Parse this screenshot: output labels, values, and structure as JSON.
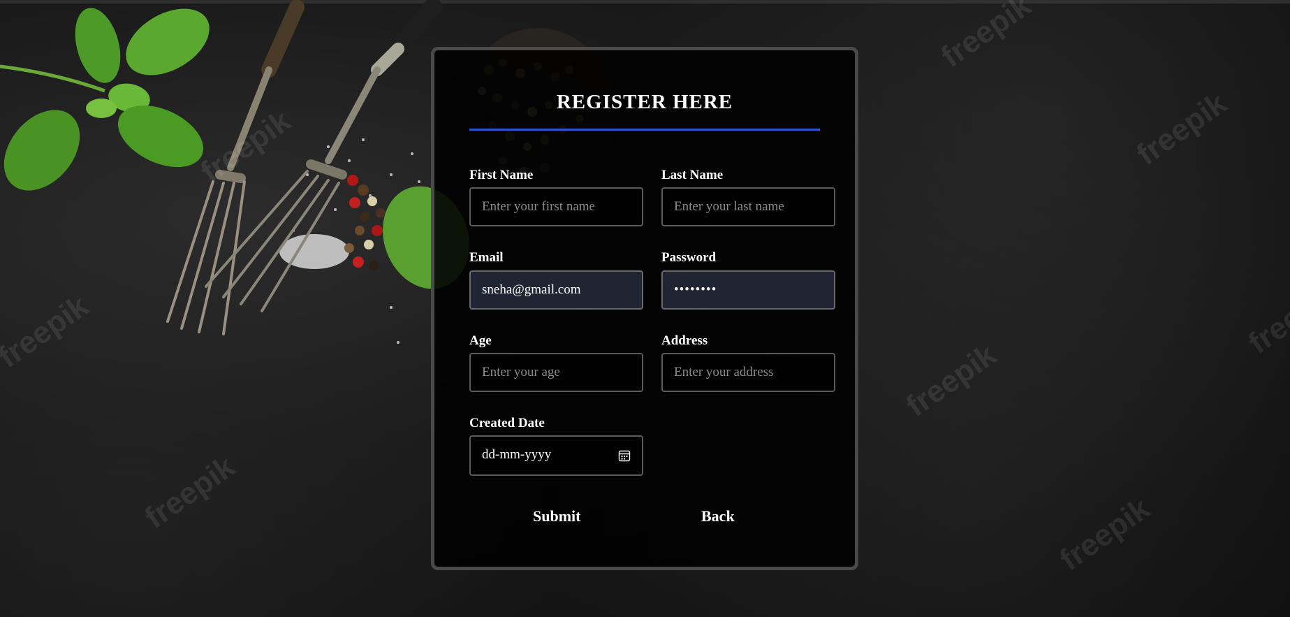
{
  "form": {
    "title": "REGISTER HERE",
    "fields": {
      "first_name": {
        "label": "First Name",
        "placeholder": "Enter your first name",
        "value": ""
      },
      "last_name": {
        "label": "Last Name",
        "placeholder": "Enter your last name",
        "value": ""
      },
      "email": {
        "label": "Email",
        "placeholder": "",
        "value": "sneha@gmail.com"
      },
      "password": {
        "label": "Password",
        "placeholder": "",
        "value": "••••••••"
      },
      "age": {
        "label": "Age",
        "placeholder": "Enter your age",
        "value": ""
      },
      "address": {
        "label": "Address",
        "placeholder": "Enter your address",
        "value": ""
      },
      "created_date": {
        "label": "Created Date",
        "placeholder": "dd-mm-yyyy",
        "icon": "calendar-icon"
      }
    },
    "buttons": {
      "submit": "Submit",
      "back": "Back"
    }
  },
  "background": {
    "watermark_text": "freepik"
  },
  "colors": {
    "accent_underline": "#2d55d6",
    "card_border": "#4a4a4a",
    "filled_input_bg": "#1f2533"
  }
}
